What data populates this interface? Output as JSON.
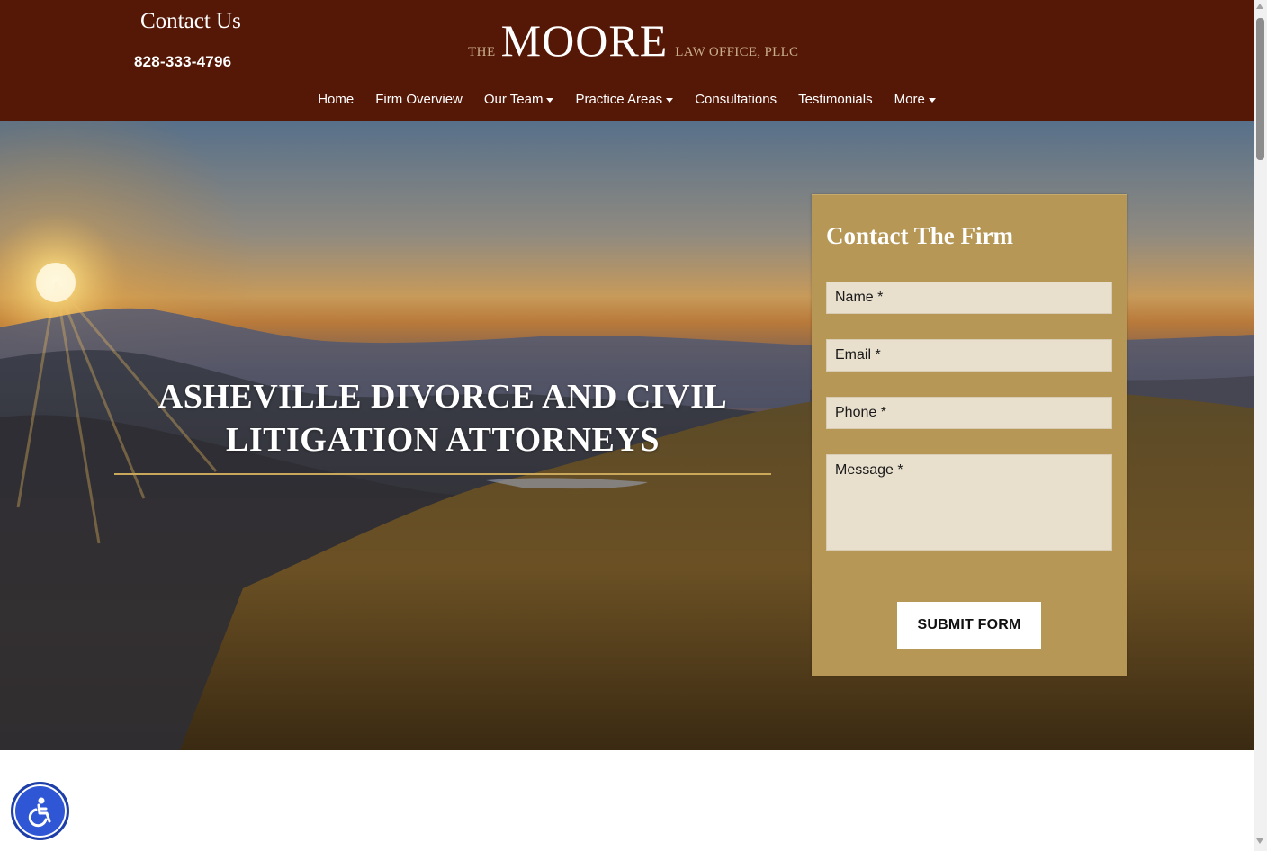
{
  "header": {
    "contact_title": "Contact Us",
    "phone": "828-333-4796",
    "logo": {
      "prefix": "THE",
      "name": "MOORE",
      "suffix": "LAW OFFICE, PLLC"
    }
  },
  "nav": {
    "items": [
      {
        "label": "Home",
        "dropdown": false
      },
      {
        "label": "Firm Overview",
        "dropdown": false
      },
      {
        "label": "Our Team",
        "dropdown": true
      },
      {
        "label": "Practice Areas",
        "dropdown": true
      },
      {
        "label": "Consultations",
        "dropdown": false
      },
      {
        "label": "Testimonials",
        "dropdown": false
      },
      {
        "label": "More",
        "dropdown": true
      }
    ]
  },
  "hero": {
    "title": "ASHEVILLE DIVORCE AND CIVIL LITIGATION ATTORNEYS"
  },
  "contact_form": {
    "title": "Contact The Firm",
    "name_placeholder": "Name *",
    "email_placeholder": "Email *",
    "phone_placeholder": "Phone *",
    "message_placeholder": "Message *",
    "submit_label": "SUBMIT FORM"
  },
  "colors": {
    "header_bg": "#561806",
    "form_bg": "#b69756",
    "accent_gold": "#c9a85c",
    "a11y_blue": "#2f56d4"
  },
  "icons": {
    "accessibility": "accessibility-wheelchair-icon",
    "dropdown": "caret-down-icon"
  }
}
